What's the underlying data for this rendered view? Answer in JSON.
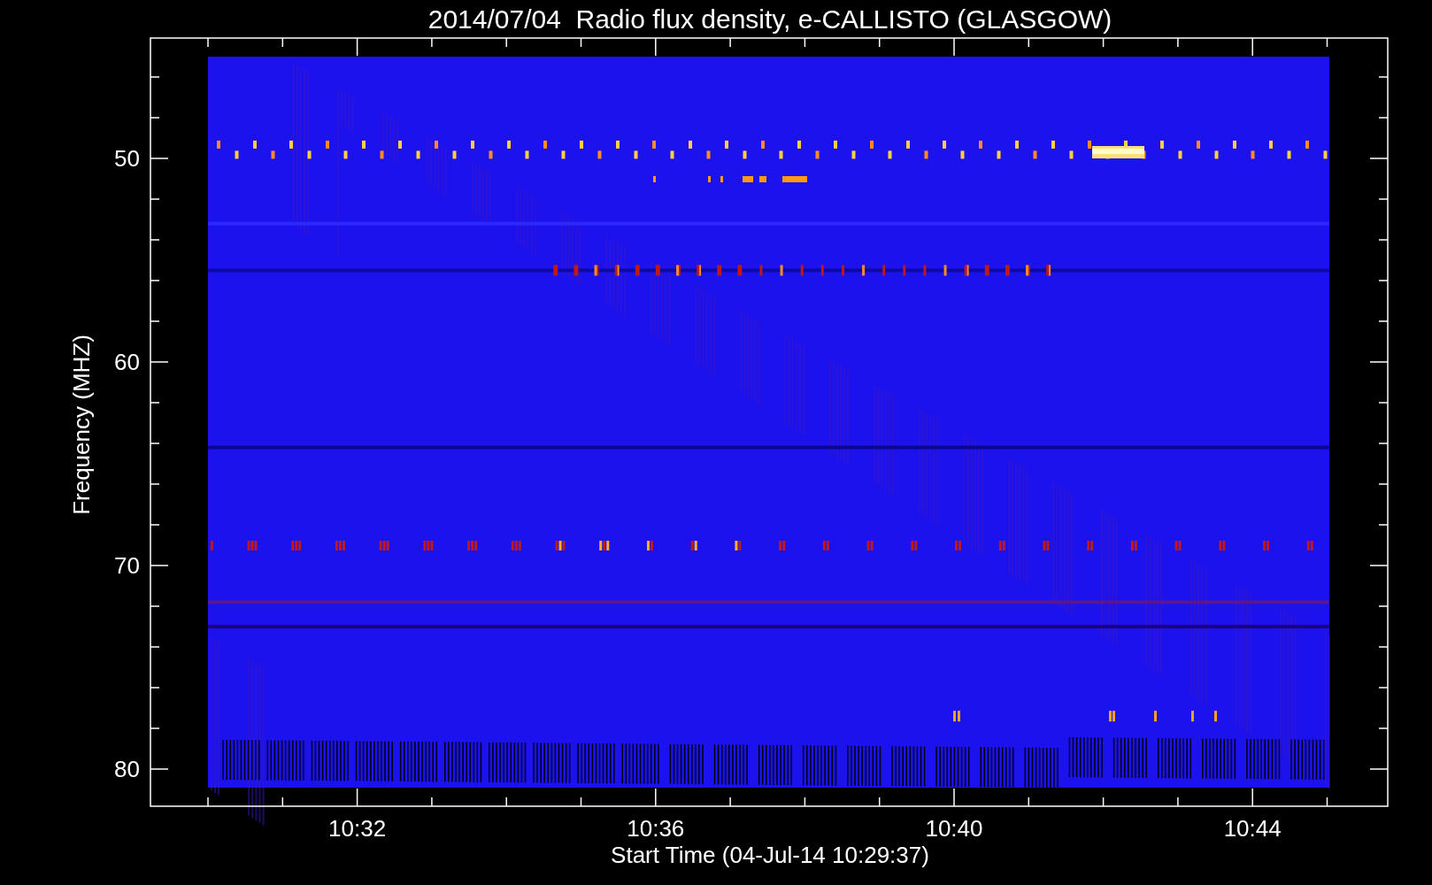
{
  "title": "2014/07/04  Radio flux density, e-CALLISTO (GLASGOW)",
  "y_axis": {
    "label": "Frequency (MHZ)",
    "ticks": [
      "50",
      "60",
      "70",
      "80"
    ]
  },
  "x_axis": {
    "label": "Start Time (04-Jul-14 10:29:37)",
    "ticks": [
      "10:32",
      "10:36",
      "10:40",
      "10:44"
    ]
  }
}
